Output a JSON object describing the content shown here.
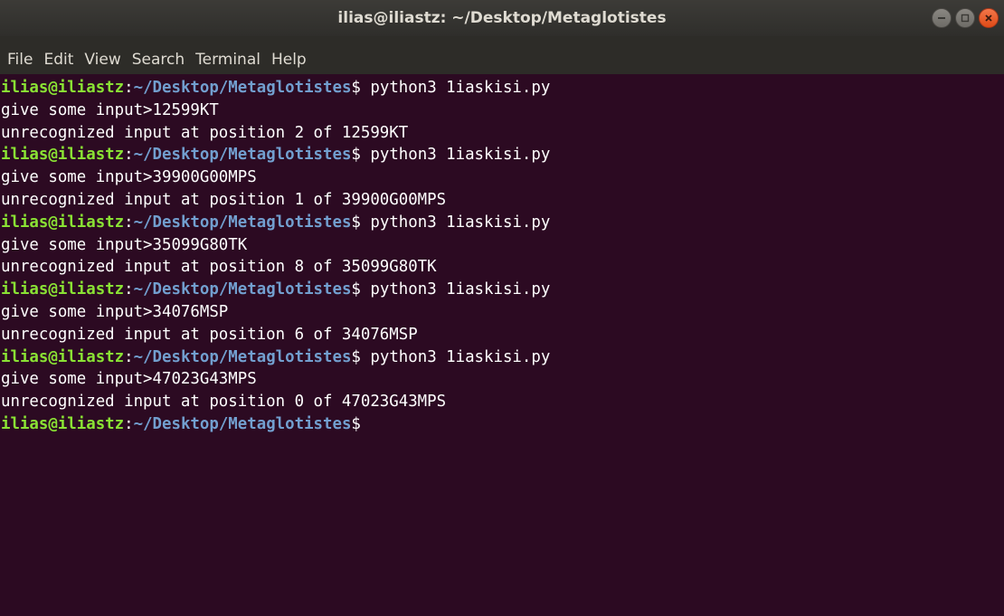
{
  "window": {
    "title": "ilias@iliastz: ~/Desktop/Metaglotistes"
  },
  "menu": [
    "File",
    "Edit",
    "View",
    "Search",
    "Terminal",
    "Help"
  ],
  "prompt": {
    "user_host": "ilias@iliastz",
    "sep": ":",
    "path": "~/Desktop/Metaglotistes",
    "symbol": "$"
  },
  "lines": [
    {
      "type": "prompt",
      "cmd": " python3 1iaskisi.py"
    },
    {
      "type": "output",
      "text": "give some input>12599KT"
    },
    {
      "type": "output",
      "text": "unrecognized input at position 2 of 12599KT"
    },
    {
      "type": "prompt",
      "cmd": " python3 1iaskisi.py"
    },
    {
      "type": "output",
      "text": "give some input>39900G00MPS"
    },
    {
      "type": "output",
      "text": "unrecognized input at position 1 of 39900G00MPS"
    },
    {
      "type": "prompt",
      "cmd": " python3 1iaskisi.py"
    },
    {
      "type": "output",
      "text": "give some input>35099G80TK"
    },
    {
      "type": "output",
      "text": "unrecognized input at position 8 of 35099G80TK"
    },
    {
      "type": "prompt",
      "cmd": " python3 1iaskisi.py"
    },
    {
      "type": "output",
      "text": "give some input>34076MSP"
    },
    {
      "type": "output",
      "text": "unrecognized input at position 6 of 34076MSP"
    },
    {
      "type": "prompt",
      "cmd": " python3 1iaskisi.py"
    },
    {
      "type": "output",
      "text": "give some input>47023G43MPS"
    },
    {
      "type": "output",
      "text": "unrecognized input at position 0 of 47023G43MPS"
    },
    {
      "type": "prompt",
      "cmd": ""
    }
  ],
  "colors": {
    "background": "#2c0a22",
    "prompt_user": "#8ae234",
    "prompt_path": "#729fcf",
    "text": "#ffffff"
  }
}
